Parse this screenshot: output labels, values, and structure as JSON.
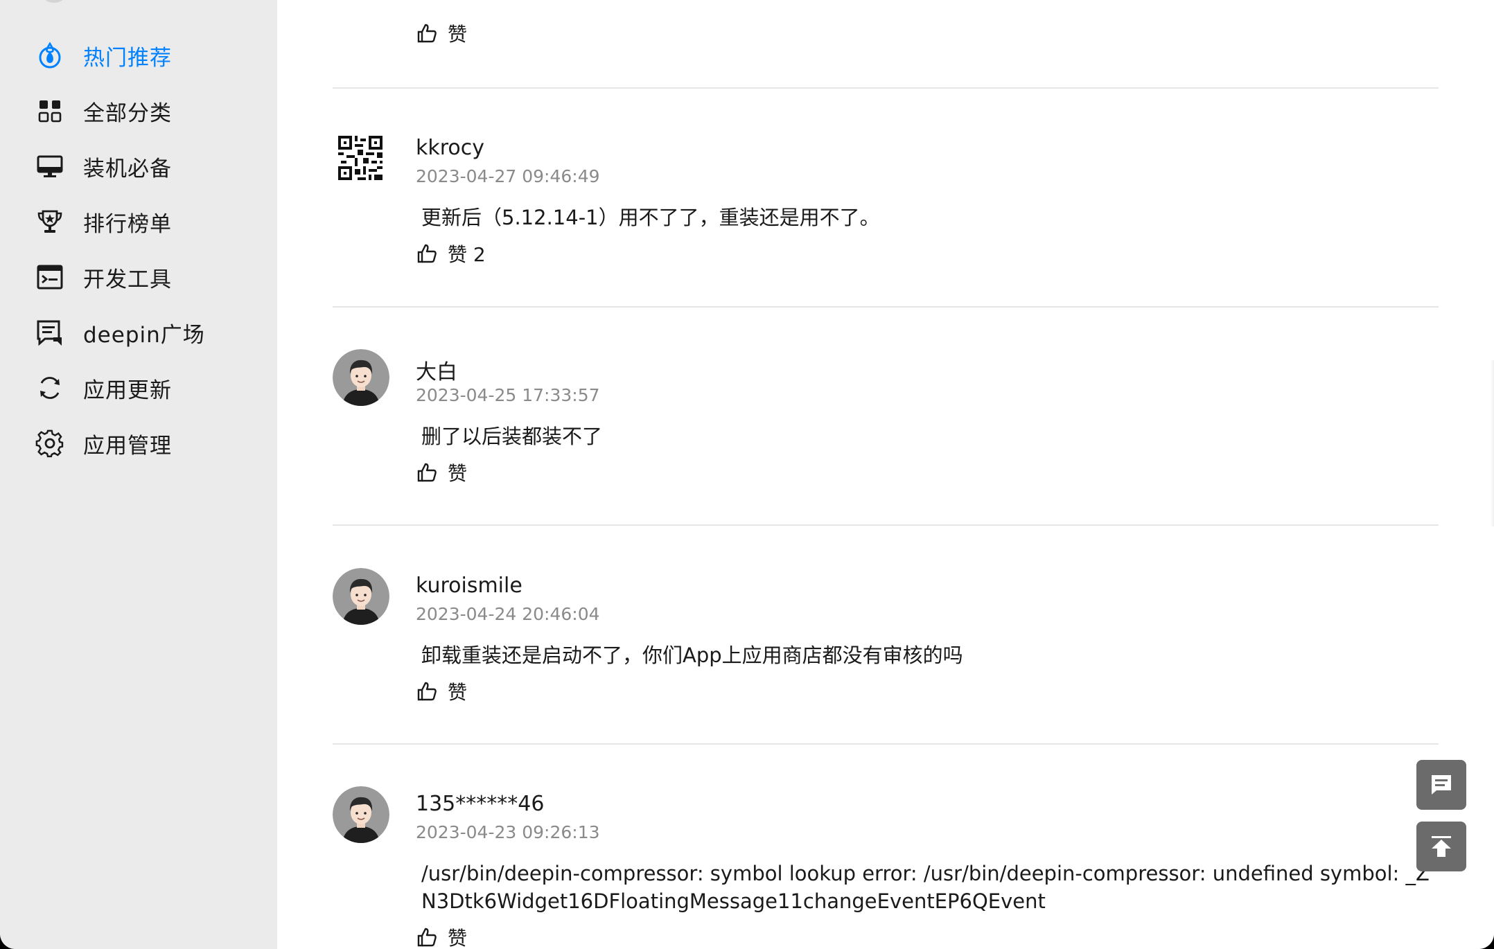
{
  "sidebar": {
    "items": [
      {
        "label": "热门推荐",
        "icon": "flame-icon",
        "active": true
      },
      {
        "label": "全部分类",
        "icon": "grid-icon",
        "active": false
      },
      {
        "label": "装机必备",
        "icon": "monitor-icon",
        "active": false
      },
      {
        "label": "排行榜单",
        "icon": "trophy-icon",
        "active": false
      },
      {
        "label": "开发工具",
        "icon": "terminal-icon",
        "active": false
      },
      {
        "label": "deepin广场",
        "icon": "forum-icon",
        "active": false
      },
      {
        "label": "应用更新",
        "icon": "refresh-icon",
        "active": false
      },
      {
        "label": "应用管理",
        "icon": "settings-gear-icon",
        "active": false
      }
    ]
  },
  "top_like": {
    "label": "赞"
  },
  "comments": [
    {
      "user": "kkrocy",
      "date": "2023-04-27 09:46:49",
      "text": "更新后（5.12.14-1）用不了了，重装还是用不了。",
      "like_label": "赞 2",
      "avatar": "qr-code-avatar"
    },
    {
      "user": "大白",
      "date": "2023-04-25 17:33:57",
      "text": "删了以后装都装不了",
      "like_label": "赞",
      "avatar": "default-avatar"
    },
    {
      "user": "kuroismile",
      "date": "2023-04-24 20:46:04",
      "text": "卸载重装还是启动不了，你们App上应用商店都没有审核的吗",
      "like_label": "赞",
      "avatar": "default-avatar"
    },
    {
      "user": "135******46",
      "date": "2023-04-23 09:26:13",
      "text": "/usr/bin/deepin-compressor: symbol lookup error: /usr/bin/deepin-compressor: undefined symbol: _ZN3Dtk6Widget16DFloatingMessage11changeEventEP6QEvent",
      "like_label": "赞",
      "avatar": "default-avatar"
    }
  ],
  "colors": {
    "accent": "#0081ff",
    "sidebar_bg": "#ebebeb",
    "fab_bg": "#6b6b6b"
  },
  "fabs": {
    "comment_icon": "comment-icon",
    "top_icon": "back-to-top-icon"
  }
}
